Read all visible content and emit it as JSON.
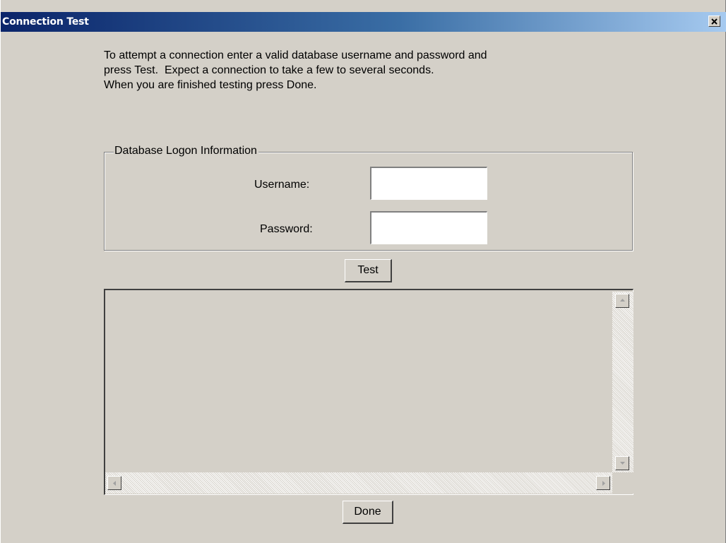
{
  "window": {
    "title": "Connection Test",
    "close_icon": "close-icon"
  },
  "instructions": {
    "line1": "To attempt a connection enter a valid database username and password and",
    "line2": "press Test.  Expect a connection to take a few to several seconds.",
    "line3": "When you are finished testing press Done."
  },
  "logon_group": {
    "legend": "Database Logon Information",
    "username_label": "Username:",
    "username_value": "",
    "password_label": "Password:",
    "password_value": ""
  },
  "buttons": {
    "test_label": "Test",
    "done_label": "Done"
  },
  "output": {
    "text": "",
    "scroll_up_icon": "arrow-up-icon",
    "scroll_down_icon": "arrow-down-icon",
    "scroll_left_icon": "arrow-left-icon",
    "scroll_right_icon": "arrow-right-icon"
  },
  "colors": {
    "title_gradient_start": "#0a246a",
    "title_gradient_end": "#a6caf0",
    "window_bg": "#d4d0c8"
  }
}
